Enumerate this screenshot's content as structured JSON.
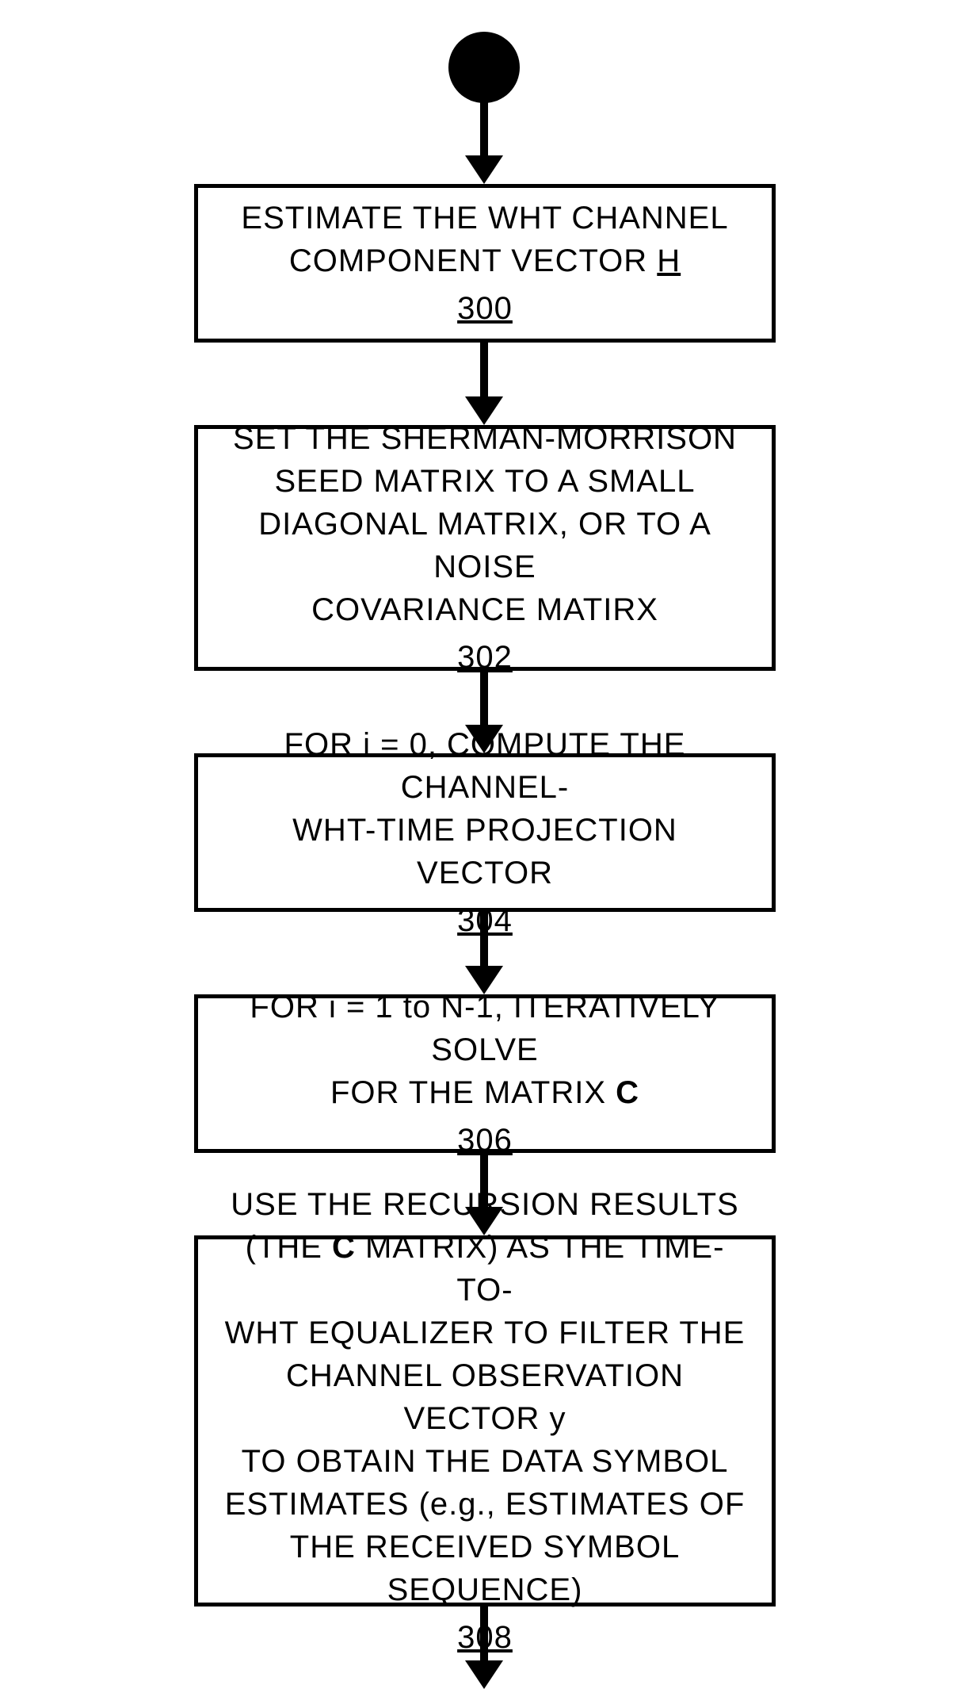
{
  "diagram": {
    "type": "flowchart",
    "direction": "top-to-bottom",
    "start": "filled-circle",
    "end": "arrow-continues",
    "steps": [
      {
        "id": "300",
        "ref": "300",
        "text_lines": [
          "ESTIMATE THE WHT CHANNEL",
          "COMPONENT VECTOR H"
        ],
        "variable_underlined": "H"
      },
      {
        "id": "302",
        "ref": "302",
        "text_lines": [
          "SET THE SHERMAN-MORRISON",
          "SEED MATRIX TO A SMALL",
          "DIAGONAL MATRIX, OR TO A NOISE",
          "COVARIANCE MATIRX"
        ]
      },
      {
        "id": "304",
        "ref": "304",
        "text_lines": [
          "FOR i = 0, COMPUTE THE CHANNEL-",
          "WHT-TIME PROJECTION VECTOR"
        ]
      },
      {
        "id": "306",
        "ref": "306",
        "text_lines": [
          "FOR i = 1 to N-1, ITERATIVELY SOLVE",
          "FOR THE MATRIX C"
        ],
        "bold_terms": [
          "C"
        ]
      },
      {
        "id": "308",
        "ref": "308",
        "text_lines": [
          "USE THE RECURSION RESULTS",
          "(THE C MATRIX) AS THE TIME-TO-",
          "WHT EQUALIZER TO FILTER THE",
          "CHANNEL OBSERVATION VECTOR y",
          "TO OBTAIN THE DATA SYMBOL",
          "ESTIMATES (e.g., ESTIMATES OF",
          "THE RECEIVED SYMBOL SEQUENCE)"
        ],
        "bold_terms": [
          "C"
        ]
      }
    ]
  }
}
